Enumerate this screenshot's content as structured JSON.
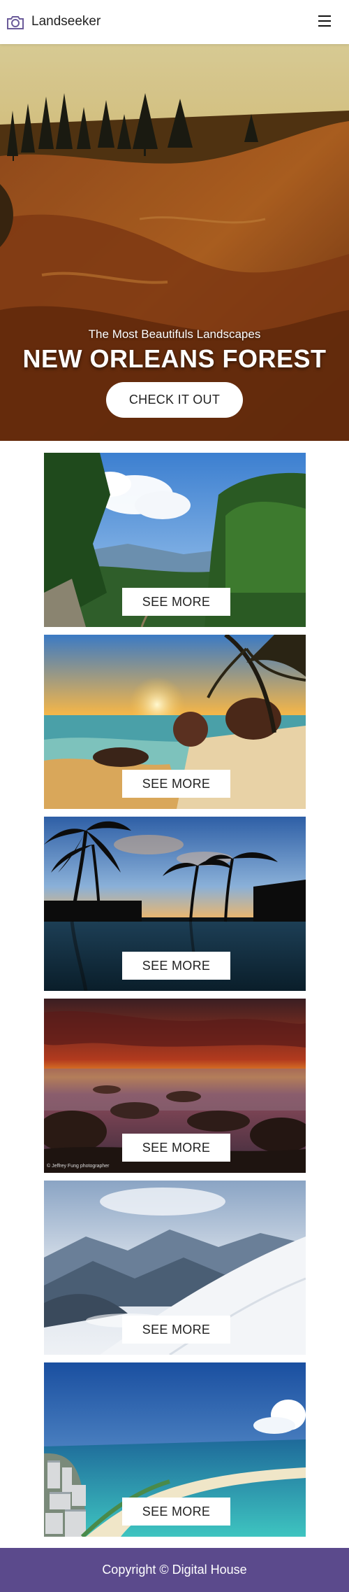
{
  "header": {
    "brand": "Landseeker",
    "logo_icon": "camera-icon",
    "menu_icon": "hamburger-menu-icon"
  },
  "hero": {
    "subtitle": "The Most Beautifuls Landscapes",
    "title": "NEW ORLEANS FOREST",
    "button_label": "CHECK IT OUT"
  },
  "cards": [
    {
      "scene": "green-mountain-valley",
      "button_label": "SEE MORE"
    },
    {
      "scene": "tropical-beach-sunset",
      "button_label": "SEE MORE"
    },
    {
      "scene": "palm-trees-pool-sunset",
      "button_label": "SEE MORE"
    },
    {
      "scene": "rocky-shore-sunset",
      "button_label": "SEE MORE",
      "watermark": "© Jeffrey Fung photographer"
    },
    {
      "scene": "snowy-mountains",
      "button_label": "SEE MORE"
    },
    {
      "scene": "coastal-city-beach",
      "button_label": "SEE MORE"
    }
  ],
  "footer": {
    "text": "Copyright © Digital House"
  },
  "colors": {
    "footer_bg": "#5b4a8c",
    "logo_accent": "#6b5b9a"
  }
}
